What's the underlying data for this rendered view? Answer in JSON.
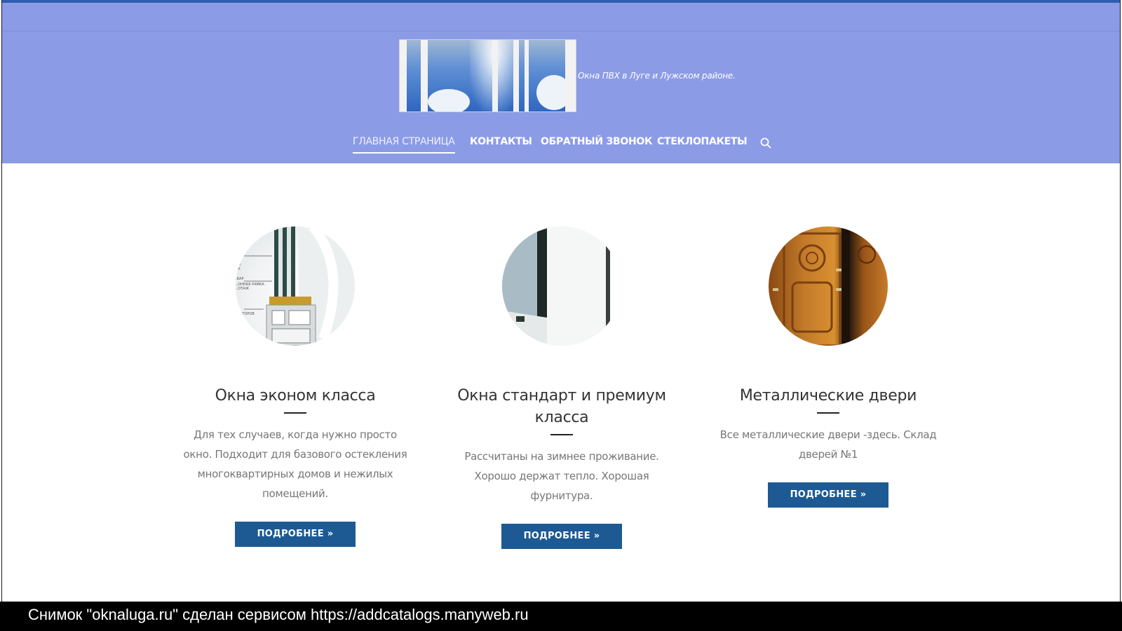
{
  "header": {
    "tagline": "Окна ПВХ в Луге и Лужском районе.",
    "nav": [
      {
        "label": "ГЛАВНАЯ СТРАНИЦА",
        "active": true
      },
      {
        "label": "КОНТАКТЫ",
        "active": false
      },
      {
        "label": "ОБРАТНЫЙ ЗВОНОК",
        "active": false
      },
      {
        "label": "СТЕКЛОПАКЕТЫ",
        "active": false
      }
    ],
    "search_icon": "search-icon"
  },
  "features": [
    {
      "title": "Окна эконом класса",
      "text": "Для тех случаев, когда нужно просто окно. Подходит для базового остекления многоквартирных домов и нежилых помещений.",
      "button": "ПОДРОБНЕЕ »",
      "image_labels": [
        "..Л",
        "..К",
        ".БАР",
        "..ОННАЯ РАМКА",
        "..ОТАЖ",
        "..ГЕТОРОВ"
      ]
    },
    {
      "title": "Окна стандарт и премиум класса",
      "text": "Рассчитаны на зимнее проживание. Хорошо держат тепло. Хорошая фурнитура.",
      "button": "ПОДРОБНЕЕ »"
    },
    {
      "title": "Металлические двери",
      "text": "Все металлические двери -здесь. Склад дверей №1",
      "button": "ПОДРОБНЕЕ »"
    }
  ],
  "footer": {
    "text": "Снимок \"oknaluga.ru\" сделан сервисом https://addcatalogs.manyweb.ru"
  },
  "colors": {
    "header_bg": "#8c9be6",
    "button_bg": "#1d5a93",
    "footer_bg": "#000000"
  }
}
